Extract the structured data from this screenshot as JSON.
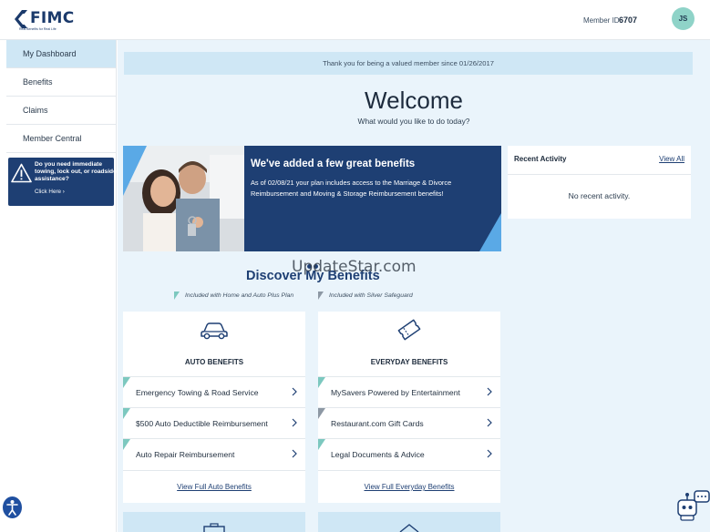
{
  "header": {
    "logo_text": "FIMC",
    "logo_tagline": "Real Benefits for Real Life",
    "member_label": "Member ID",
    "member_id": "6707",
    "avatar_initials": "JS"
  },
  "sidebar": {
    "items": [
      {
        "label": "My Dashboard"
      },
      {
        "label": "Benefits"
      },
      {
        "label": "Claims"
      },
      {
        "label": "Member Central"
      }
    ],
    "assist_text": "Do you need immediate towing, lock out, or roadside assistance?",
    "assist_link": "Click Here ›"
  },
  "main": {
    "banner": "Thank you for being a valued member since 01/26/2017",
    "welcome_title": "Welcome",
    "welcome_subtitle": "What would you like to do today?",
    "promo": {
      "title": "We've added a few great benefits",
      "body": "As of 02/08/21 your plan includes access to the Marriage & Divorce Reimbursement and Moving & Storage Reimbursement benefits!"
    },
    "recent": {
      "title": "Recent Activity",
      "view_all": "View All",
      "empty": "No recent activity."
    },
    "discover_title": "Discover My Benefits",
    "watermark": "UpdateStar.com",
    "plan_notes": [
      "Included with Home and Auto Plus Plan",
      "Included with Silver Safeguard"
    ],
    "cards": [
      {
        "title": "AUTO BENEFITS",
        "icon": "car-icon",
        "rows": [
          "Emergency Towing & Road Service",
          "$500 Auto Deductible Reimbursement",
          "Auto Repair Reimbursement"
        ],
        "footer": "View Full Auto Benefits"
      },
      {
        "title": "EVERYDAY BENEFITS",
        "icon": "ticket-icon",
        "rows": [
          "MySavers Powered by Entertainment",
          "Restaurant.com Gift Cards",
          "Legal Documents & Advice"
        ],
        "footer": "View Full Everyday Benefits"
      }
    ]
  },
  "colors": {
    "brand_navy": "#1e3f73",
    "light_blue": "#cfe7f5",
    "page_bg": "#eaf4fb",
    "teal_flag": "#7cc8bf",
    "gray_flag": "#8d98a4",
    "avatar": "#8fd3c8"
  }
}
